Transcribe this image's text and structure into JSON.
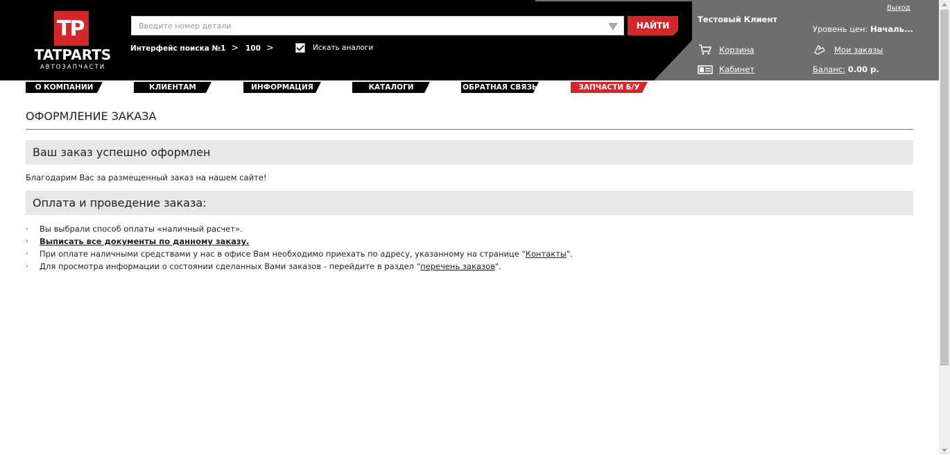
{
  "logo": {
    "mark": "TP",
    "name": "TATPARTS",
    "tagline": "АВТОЗАПЧАСТИ"
  },
  "search": {
    "placeholder": "Введите номер детали",
    "value": "",
    "button_label": "НАЙТИ",
    "interface_label": "Интерфейс поиска №1",
    "count_label": "100",
    "analogs_label": "Искать аналоги",
    "analogs_checked": true
  },
  "user": {
    "name": "Тестовый Клиент",
    "logout": "Выход",
    "price_level_label": "Уровень цен:",
    "price_level_value": "Началь...",
    "cart_label": "Корзина",
    "orders_label": "Мои заказы",
    "cabinet_label": "Кабинет",
    "balance_label": "Баланс:",
    "balance_value": "0.00 р."
  },
  "nav": [
    {
      "label": "О КОМПАНИИ"
    },
    {
      "label": "КЛИЕНТАМ"
    },
    {
      "label": "ИНФОРМАЦИЯ"
    },
    {
      "label": "КАТАЛОГИ"
    },
    {
      "label": "ОБРАТНАЯ СВЯЗЬ"
    },
    {
      "label": "ЗАПЧАСТИ Б/У"
    }
  ],
  "colors": {
    "brand_red": "#d3272a",
    "header_bg": "#000000",
    "user_panel_bg": "#6e6e6e",
    "box_bg": "#e7e7e7"
  },
  "content": {
    "title": "ОФОРМЛЕНИЕ ЗАКАЗА",
    "success_heading": "Ваш заказ успешно оформлен",
    "thanks_text": "Благодарим Вас за размещенный заказ на нашем сайте!",
    "payment_heading": "Оплата и проведение заказа:",
    "item1": "Вы выбрали способ оплаты «наличный расчет».",
    "item2": "Выписать все документы по данному заказу.",
    "item3_pre": "При оплате наличными средствами у нас в офисе Вам необходимо приехать по адресу, указанному на странице \"",
    "item3_link": "Контакты",
    "item3_post": "\".",
    "item4_pre": "Для просмотра информации о состоянии сделанных Вами заказов - перейдите в раздел \"",
    "item4_link": "перечень заказов",
    "item4_post": "\"."
  }
}
